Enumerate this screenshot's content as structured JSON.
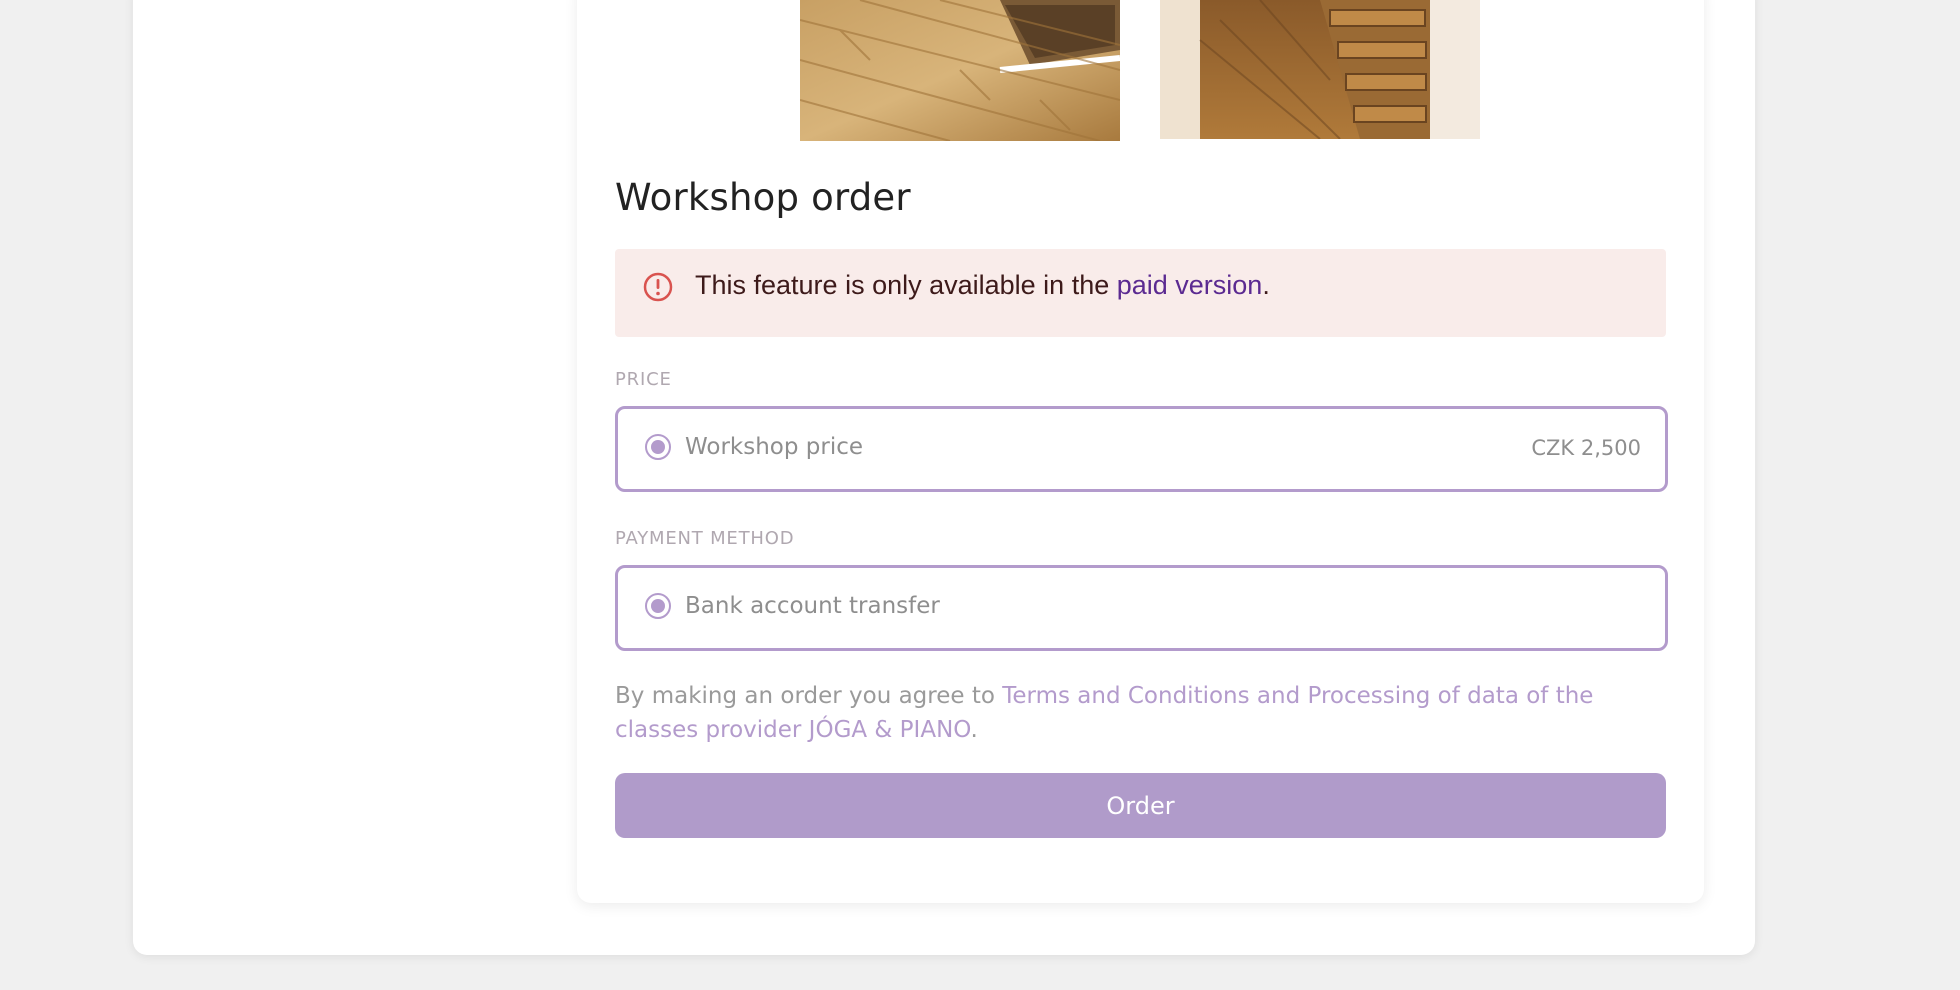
{
  "workshop_order": {
    "title": "Workshop order",
    "alert": {
      "icon": "exclamation-circle-icon",
      "text_before": "This feature is only available in the ",
      "link_text": "paid version",
      "text_after": "."
    },
    "price_section": {
      "label": "PRICE",
      "option_label": "Workshop price",
      "option_value": "CZK 2,500"
    },
    "payment_section": {
      "label": "PAYMENT METHOD",
      "option_label": "Bank account transfer"
    },
    "terms": {
      "text_before": "By making an order you agree to ",
      "link_text": "Terms and Conditions and Processing of data of the classes provider JÓGA & PIANO",
      "text_after": "."
    },
    "order_button_label": "Order"
  },
  "colors": {
    "accent": "#b09bca",
    "alert_bg": "#f9ecea",
    "alert_icon": "#d9534f",
    "link": "#5b2a91"
  }
}
